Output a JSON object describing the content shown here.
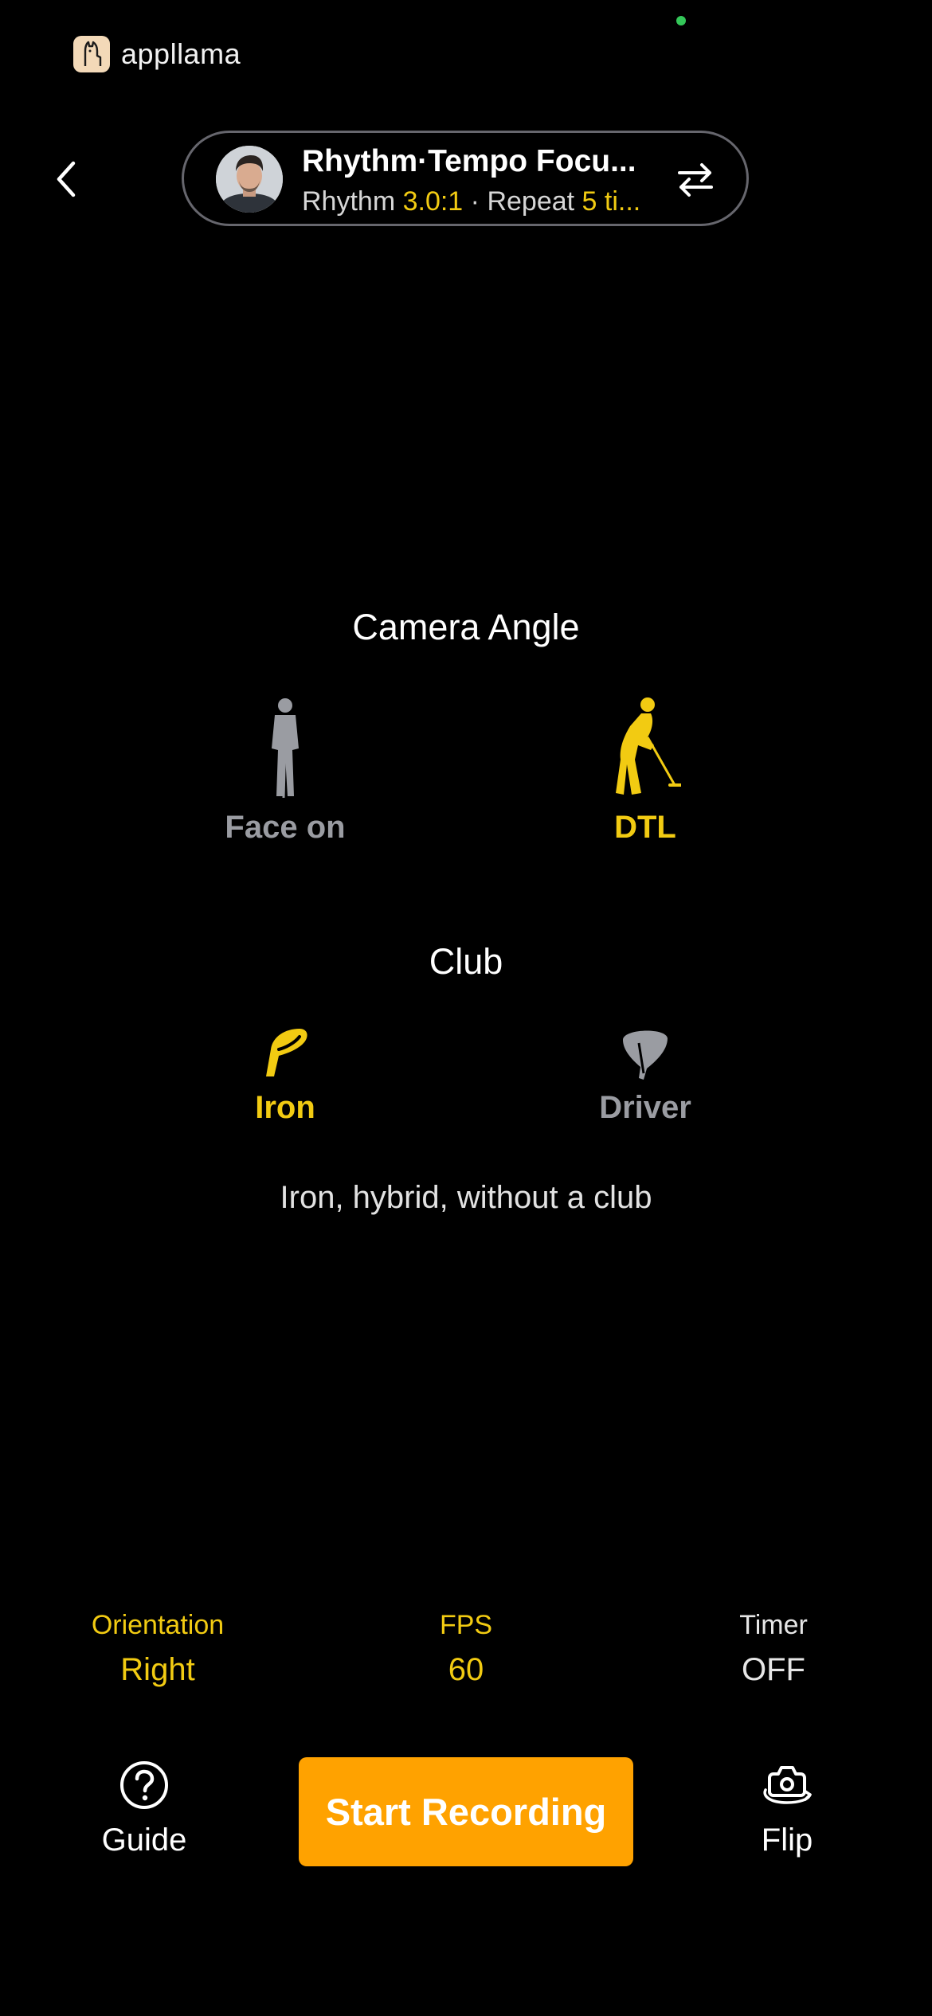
{
  "status": {
    "dot_color": "#34c759"
  },
  "app": {
    "name": "appllama"
  },
  "session": {
    "title": "Rhythm·Tempo Focu...",
    "rhythm_label": "Rhythm",
    "rhythm_value": "3.0:1",
    "separator": "·",
    "repeat_label": "Repeat",
    "repeat_value": "5 ti..."
  },
  "camera_angle": {
    "heading": "Camera Angle",
    "options": [
      {
        "label": "Face on",
        "selected": false
      },
      {
        "label": "DTL",
        "selected": true
      }
    ]
  },
  "club": {
    "heading": "Club",
    "options": [
      {
        "label": "Iron",
        "selected": true
      },
      {
        "label": "Driver",
        "selected": false
      }
    ],
    "description": "Iron, hybrid, without a club"
  },
  "settings": {
    "orientation": {
      "label": "Orientation",
      "value": "Right"
    },
    "fps": {
      "label": "FPS",
      "value": "60"
    },
    "timer": {
      "label": "Timer",
      "value": "OFF"
    }
  },
  "actions": {
    "guide": "Guide",
    "start": "Start Recording",
    "flip": "Flip"
  },
  "colors": {
    "accent_yellow": "#f2cb12",
    "button_orange": "#ffa200",
    "inactive_gray": "#9a9ca2"
  }
}
